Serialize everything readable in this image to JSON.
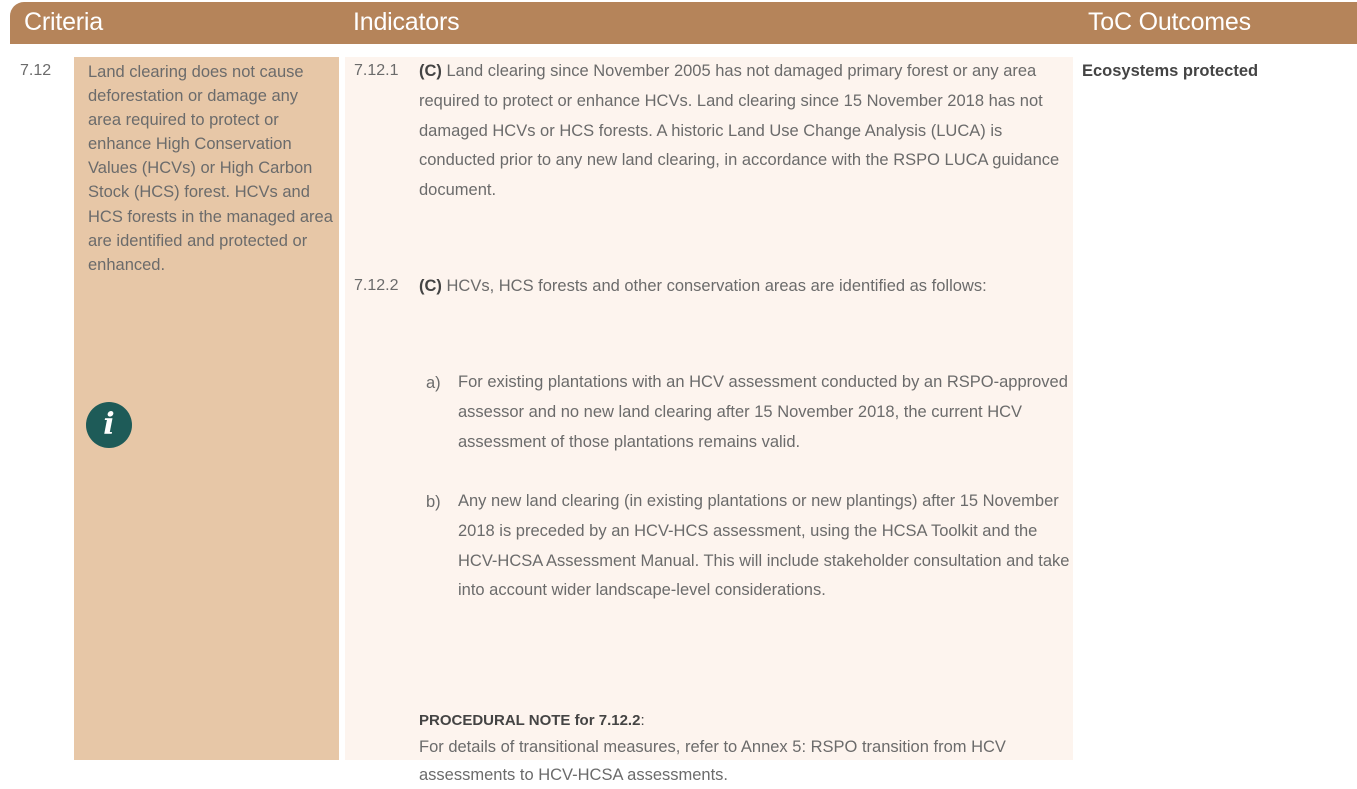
{
  "header": {
    "criteria": "Criteria",
    "indicators": "Indicators",
    "toc_outcomes": "ToC Outcomes"
  },
  "criterion": {
    "number": "7.12",
    "text": "Land clearing does not cause deforestation or damage any area required to protect or enhance High Conservation Values (HCVs) or High Carbon Stock (HCS) forest. HCVs and HCS forests in the managed area are identified and protected or enhanced.",
    "icon": "info-icon"
  },
  "indicators": [
    {
      "number": "7.12.1",
      "tag": "(C)",
      "text": " Land clearing since November 2005 has not damaged primary forest or any area required to protect or enhance HCVs. Land clearing since 15 November 2018 has not damaged HCVs or HCS forests. A historic Land Use Change Analysis (LUCA) is conducted prior to any new land clearing, in accordance with the RSPO LUCA guidance document."
    },
    {
      "number": "7.12.2",
      "tag": "(C)",
      "text": " HCVs, HCS forests and other conservation areas are identified as follows:",
      "items": [
        {
          "label": "a)",
          "text": "For existing plantations with an HCV assessment conducted by an RSPO-approved assessor and no new land clearing after 15 November 2018, the current HCV assessment of those plantations remains valid."
        },
        {
          "label": "b)",
          "text": "Any new land clearing (in existing plantations or new plantings) after 15 November 2018 is preceded by an HCV-HCS assessment, using the HCSA Toolkit and the HCV-HCSA Assessment Manual. This will include stakeholder consultation and take into account wider landscape-level considerations."
        }
      ],
      "procedural_note": {
        "title": "PROCEDURAL NOTE for 7.12.2",
        "colon": ":",
        "text": "For details of transitional measures, refer to Annex 5: RSPO transition from HCV assessments to HCV-HCSA assessments."
      }
    }
  ],
  "toc_outcome": "Ecosystems protected",
  "colors": {
    "header_bg": "#b5845a",
    "criteria_bg": "#e7c7a7",
    "indicators_bg": "#fdf4ee",
    "icon_bg": "#1e5b58"
  }
}
